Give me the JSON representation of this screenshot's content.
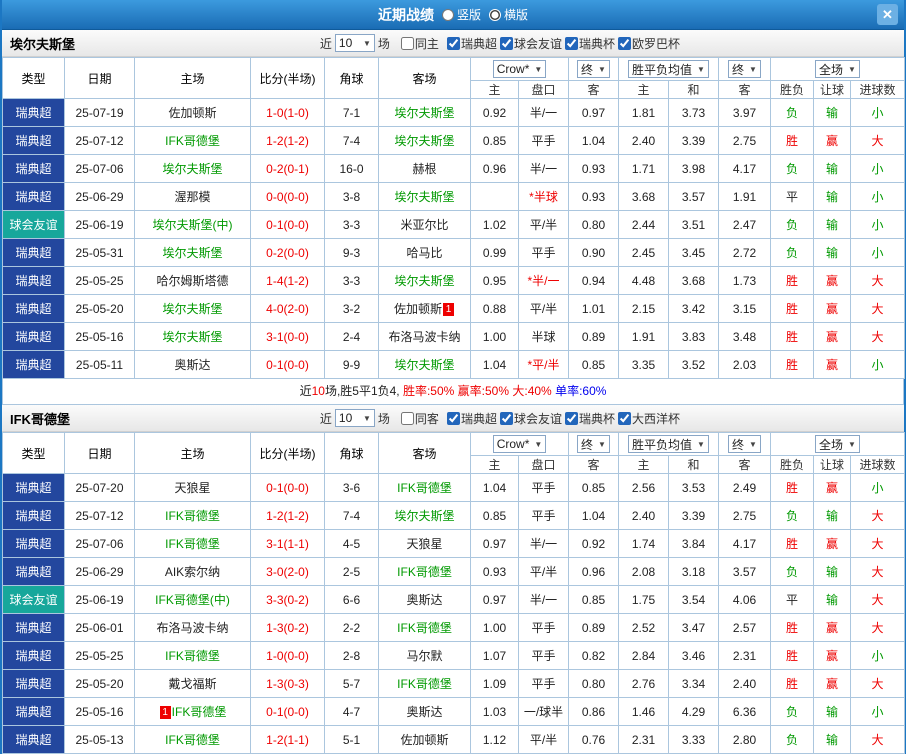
{
  "topbar": {
    "title": "近期战绩",
    "options": [
      {
        "label": "竖版",
        "selected": false
      },
      {
        "label": "横版",
        "selected": true
      }
    ],
    "close": "✕"
  },
  "table_header": {
    "static_columns": [
      "类型",
      "日期",
      "主场",
      "比分(半场)",
      "角球",
      "客场"
    ],
    "selects": {
      "odds_source": "Crow*",
      "odds_final": "终",
      "avg": "胜平负均值",
      "avg_final": "终",
      "scope": "全场"
    },
    "odds_subcolumns": [
      "主",
      "盘口",
      "客"
    ],
    "avg_subcolumns": [
      "主",
      "和",
      "客"
    ],
    "result_columns": [
      "胜负",
      "让球",
      "进球数"
    ]
  },
  "highlight_teams": [
    "埃尔夫斯堡",
    "IFK哥德堡"
  ],
  "sections": [
    {
      "team": "埃尔夫斯堡",
      "filters": {
        "near": "近",
        "count": "10",
        "unit": "场",
        "venue": {
          "label": "同主",
          "checked": false
        },
        "leagues": [
          {
            "label": "瑞典超",
            "checked": true
          },
          {
            "label": "球会友谊",
            "checked": true
          },
          {
            "label": "瑞典杯",
            "checked": true
          },
          {
            "label": "欧罗巴杯",
            "checked": true
          }
        ]
      },
      "rows": [
        {
          "type": "瑞典超",
          "date": "25-07-19",
          "home": "佐加顿斯",
          "score": "1-0(1-0)",
          "corner": "7-1",
          "away": "埃尔夫斯堡",
          "odds": [
            "0.92",
            "半/一",
            "0.97"
          ],
          "avg": [
            "1.81",
            "3.73",
            "3.97"
          ],
          "results": [
            "负",
            "输",
            "小"
          ]
        },
        {
          "type": "瑞典超",
          "date": "25-07-12",
          "home": "IFK哥德堡",
          "score": "1-2(1-2)",
          "corner": "7-4",
          "away": "埃尔夫斯堡",
          "odds": [
            "0.85",
            "平手",
            "1.04"
          ],
          "avg": [
            "2.40",
            "3.39",
            "2.75"
          ],
          "results": [
            "胜",
            "赢",
            "大"
          ]
        },
        {
          "type": "瑞典超",
          "date": "25-07-06",
          "home": "埃尔夫斯堡",
          "score": "0-2(0-1)",
          "corner": "16-0",
          "away": "赫根",
          "odds": [
            "0.96",
            "半/一",
            "0.93"
          ],
          "avg": [
            "1.71",
            "3.98",
            "4.17"
          ],
          "results": [
            "负",
            "输",
            "小"
          ]
        },
        {
          "type": "瑞典超",
          "date": "25-06-29",
          "home": "渥那模",
          "score": "0-0(0-0)",
          "corner": "3-8",
          "away": "埃尔夫斯堡",
          "odds": [
            "",
            "*半球",
            "0.93"
          ],
          "avg": [
            "3.68",
            "3.57",
            "1.91"
          ],
          "results": [
            "平",
            "输",
            "小"
          ]
        },
        {
          "type": "球会友谊",
          "date": "25-06-19",
          "home": "埃尔夫斯堡(中)",
          "score": "0-1(0-0)",
          "corner": "3-3",
          "away": "米亚尔比",
          "odds": [
            "1.02",
            "平/半",
            "0.80"
          ],
          "avg": [
            "2.44",
            "3.51",
            "2.47"
          ],
          "results": [
            "负",
            "输",
            "小"
          ]
        },
        {
          "type": "瑞典超",
          "date": "25-05-31",
          "home": "埃尔夫斯堡",
          "score": "0-2(0-0)",
          "corner": "9-3",
          "away": "哈马比",
          "odds": [
            "0.99",
            "平手",
            "0.90"
          ],
          "avg": [
            "2.45",
            "3.45",
            "2.72"
          ],
          "results": [
            "负",
            "输",
            "小"
          ]
        },
        {
          "type": "瑞典超",
          "date": "25-05-25",
          "home": "哈尔姆斯塔德",
          "score": "1-4(1-2)",
          "corner": "3-3",
          "away": "埃尔夫斯堡",
          "odds": [
            "0.95",
            "*半/一",
            "0.94"
          ],
          "avg": [
            "4.48",
            "3.68",
            "1.73"
          ],
          "results": [
            "胜",
            "赢",
            "大"
          ]
        },
        {
          "type": "瑞典超",
          "date": "25-05-20",
          "home": "埃尔夫斯堡",
          "score": "4-0(2-0)",
          "corner": "3-2",
          "away": "佐加顿斯",
          "away_card": "1",
          "odds": [
            "0.88",
            "平/半",
            "1.01"
          ],
          "avg": [
            "2.15",
            "3.42",
            "3.15"
          ],
          "results": [
            "胜",
            "赢",
            "大"
          ]
        },
        {
          "type": "瑞典超",
          "date": "25-05-16",
          "home": "埃尔夫斯堡",
          "score": "3-1(0-0)",
          "corner": "2-4",
          "away": "布洛马波卡纳",
          "odds": [
            "1.00",
            "半球",
            "0.89"
          ],
          "avg": [
            "1.91",
            "3.83",
            "3.48"
          ],
          "results": [
            "胜",
            "赢",
            "大"
          ]
        },
        {
          "type": "瑞典超",
          "date": "25-05-11",
          "home": "奥斯达",
          "score": "0-1(0-0)",
          "corner": "9-9",
          "away": "埃尔夫斯堡",
          "odds": [
            "1.04",
            "*平/半",
            "0.85"
          ],
          "avg": [
            "3.35",
            "3.52",
            "2.03"
          ],
          "results": [
            "胜",
            "赢",
            "小"
          ]
        }
      ],
      "summary": [
        {
          "text": "近",
          "color": "black"
        },
        {
          "text": "10",
          "color": "red"
        },
        {
          "text": "场,胜5平1负4, ",
          "color": "black"
        },
        {
          "text": "胜率:50%",
          "color": "red"
        },
        {
          "text": " ",
          "color": "black"
        },
        {
          "text": "赢率:50%",
          "color": "red"
        },
        {
          "text": " ",
          "color": "black"
        },
        {
          "text": "大:40%",
          "color": "red"
        },
        {
          "text": " ",
          "color": "black"
        },
        {
          "text": "单率:60%",
          "color": "blue"
        }
      ]
    },
    {
      "team": "IFK哥德堡",
      "filters": {
        "near": "近",
        "count": "10",
        "unit": "场",
        "venue": {
          "label": "同客",
          "checked": false
        },
        "leagues": [
          {
            "label": "瑞典超",
            "checked": true
          },
          {
            "label": "球会友谊",
            "checked": true
          },
          {
            "label": "瑞典杯",
            "checked": true
          },
          {
            "label": "大西洋杯",
            "checked": true
          }
        ]
      },
      "rows": [
        {
          "type": "瑞典超",
          "date": "25-07-20",
          "home": "天狼星",
          "score": "0-1(0-0)",
          "corner": "3-6",
          "away": "IFK哥德堡",
          "odds": [
            "1.04",
            "平手",
            "0.85"
          ],
          "avg": [
            "2.56",
            "3.53",
            "2.49"
          ],
          "results": [
            "胜",
            "赢",
            "小"
          ]
        },
        {
          "type": "瑞典超",
          "date": "25-07-12",
          "home": "IFK哥德堡",
          "score": "1-2(1-2)",
          "corner": "7-4",
          "away": "埃尔夫斯堡",
          "odds": [
            "0.85",
            "平手",
            "1.04"
          ],
          "avg": [
            "2.40",
            "3.39",
            "2.75"
          ],
          "results": [
            "负",
            "输",
            "大"
          ]
        },
        {
          "type": "瑞典超",
          "date": "25-07-06",
          "home": "IFK哥德堡",
          "score": "3-1(1-1)",
          "corner": "4-5",
          "away": "天狼星",
          "odds": [
            "0.97",
            "半/一",
            "0.92"
          ],
          "avg": [
            "1.74",
            "3.84",
            "4.17"
          ],
          "results": [
            "胜",
            "赢",
            "大"
          ]
        },
        {
          "type": "瑞典超",
          "date": "25-06-29",
          "home": "AIK索尔纳",
          "score": "3-0(2-0)",
          "corner": "2-5",
          "away": "IFK哥德堡",
          "odds": [
            "0.93",
            "平/半",
            "0.96"
          ],
          "avg": [
            "2.08",
            "3.18",
            "3.57"
          ],
          "results": [
            "负",
            "输",
            "大"
          ]
        },
        {
          "type": "球会友谊",
          "date": "25-06-19",
          "home": "IFK哥德堡(中)",
          "score": "3-3(0-2)",
          "corner": "6-6",
          "away": "奥斯达",
          "odds": [
            "0.97",
            "半/一",
            "0.85"
          ],
          "avg": [
            "1.75",
            "3.54",
            "4.06"
          ],
          "results": [
            "平",
            "输",
            "大"
          ]
        },
        {
          "type": "瑞典超",
          "date": "25-06-01",
          "home": "布洛马波卡纳",
          "score": "1-3(0-2)",
          "corner": "2-2",
          "away": "IFK哥德堡",
          "odds": [
            "1.00",
            "平手",
            "0.89"
          ],
          "avg": [
            "2.52",
            "3.47",
            "2.57"
          ],
          "results": [
            "胜",
            "赢",
            "大"
          ]
        },
        {
          "type": "瑞典超",
          "date": "25-05-25",
          "home": "IFK哥德堡",
          "score": "1-0(0-0)",
          "corner": "2-8",
          "away": "马尔默",
          "odds": [
            "1.07",
            "平手",
            "0.82"
          ],
          "avg": [
            "2.84",
            "3.46",
            "2.31"
          ],
          "results": [
            "胜",
            "赢",
            "小"
          ]
        },
        {
          "type": "瑞典超",
          "date": "25-05-20",
          "home": "戴戈福斯",
          "score": "1-3(0-3)",
          "corner": "5-7",
          "away": "IFK哥德堡",
          "odds": [
            "1.09",
            "平手",
            "0.80"
          ],
          "avg": [
            "2.76",
            "3.34",
            "2.40"
          ],
          "results": [
            "胜",
            "赢",
            "大"
          ]
        },
        {
          "type": "瑞典超",
          "date": "25-05-16",
          "home": "IFK哥德堡",
          "home_card": "1",
          "home_card_before": true,
          "score": "0-1(0-0)",
          "corner": "4-7",
          "away": "奥斯达",
          "odds": [
            "1.03",
            "一/球半",
            "0.86"
          ],
          "avg": [
            "1.46",
            "4.29",
            "6.36"
          ],
          "results": [
            "负",
            "输",
            "小"
          ]
        },
        {
          "type": "瑞典超",
          "date": "25-05-13",
          "home": "IFK哥德堡",
          "score": "1-2(1-1)",
          "corner": "5-1",
          "away": "佐加顿斯",
          "odds": [
            "1.12",
            "平/半",
            "0.76"
          ],
          "avg": [
            "2.31",
            "3.33",
            "2.80"
          ],
          "results": [
            "负",
            "输",
            "大"
          ]
        }
      ]
    }
  ],
  "colors": {
    "topbar_blue": "#1a6cb4",
    "league_blue": "#23479e",
    "friendly_teal": "#17a79b",
    "team_green": "#009900",
    "score_red": "#ee0000",
    "win_red": "#ee0000",
    "lose_green": "#009900",
    "draw_black": "#222222",
    "border_blue": "#abc6de"
  }
}
